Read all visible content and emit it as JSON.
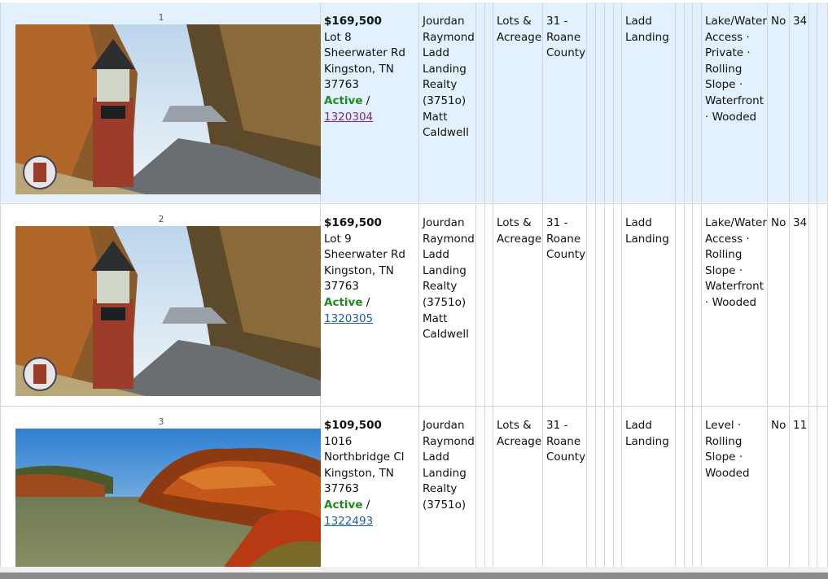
{
  "rows": [
    {
      "num": "1",
      "price": "$169,500",
      "address1": "Lot 8 Sheerwater Rd",
      "address2": "Kingston, TN 37763",
      "status": "Active",
      "sep": " / ",
      "mls": "1320304",
      "agent": "Jourdan Raymond Ladd Landing Realty (3751o) Matt Caldwell",
      "type": "Lots & Acreage",
      "county": "31 - Roane County",
      "subdivision": "Ladd Landing",
      "features": "Lake/Water Access · Private · Rolling Slope · Waterfront · Wooded",
      "hoa": "No",
      "dom": "34",
      "photo": "entrance-pillar"
    },
    {
      "num": "2",
      "price": "$169,500",
      "address1": "Lot 9 Sheerwater Rd",
      "address2": "Kingston, TN 37763",
      "status": "Active",
      "sep": " / ",
      "mls": "1320305",
      "agent": "Jourdan Raymond Ladd Landing Realty (3751o) Matt Caldwell",
      "type": "Lots & Acreage",
      "county": "31 - Roane County",
      "subdivision": "Ladd Landing",
      "features": "Lake/Water Access · Rolling Slope · Waterfront · Wooded",
      "hoa": "No",
      "dom": "34",
      "photo": "entrance-pillar"
    },
    {
      "num": "3",
      "price": "$109,500",
      "address1": "1016 Northbridge Cl",
      "address2": "Kingston, TN 37763",
      "status": "Active",
      "sep": " / ",
      "mls": "1322493",
      "agent": "Jourdan Raymond Ladd Landing Realty (3751o)",
      "type": "Lots & Acreage",
      "county": "31 - Roane County",
      "subdivision": "Ladd Landing",
      "features": "Level · Rolling Slope · Wooded",
      "hoa": "No",
      "dom": "11",
      "photo": "autumn-lake"
    }
  ],
  "colors": {
    "row_highlight": "#e2f1fd",
    "status_active": "#1f8b1f",
    "link": "#1f5fa8",
    "link_visited": "#7a2a8a"
  }
}
